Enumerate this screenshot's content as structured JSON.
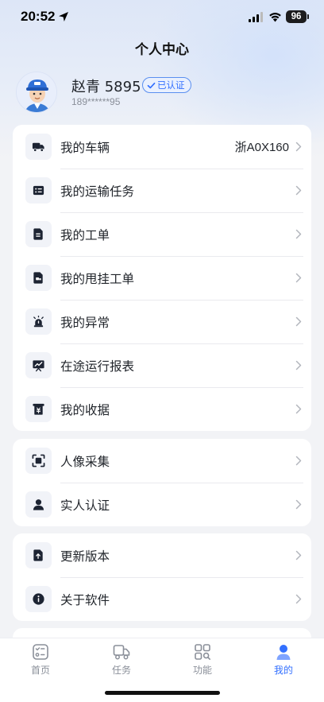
{
  "status_bar": {
    "time": "20:52",
    "battery": "96"
  },
  "page": {
    "title": "个人中心"
  },
  "profile": {
    "name": "赵青 5895",
    "verified_label": "已认证",
    "phone": "189******95"
  },
  "groups": [
    {
      "items": [
        {
          "label": "我的车辆",
          "value": "浙A0X160",
          "icon": "truck-icon"
        },
        {
          "label": "我的运输任务",
          "icon": "task-list-icon"
        },
        {
          "label": "我的工单",
          "icon": "work-order-icon"
        },
        {
          "label": "我的甩挂工单",
          "icon": "trailer-order-icon"
        },
        {
          "label": "我的异常",
          "icon": "alarm-icon"
        },
        {
          "label": "在途运行报表",
          "icon": "report-icon"
        },
        {
          "label": "我的收据",
          "icon": "receipt-icon"
        }
      ]
    },
    {
      "items": [
        {
          "label": "人像采集",
          "icon": "face-scan-icon"
        },
        {
          "label": "实人认证",
          "icon": "person-icon"
        }
      ]
    },
    {
      "items": [
        {
          "label": "更新版本",
          "icon": "update-icon"
        },
        {
          "label": "关于软件",
          "icon": "info-icon"
        }
      ]
    }
  ],
  "tab_bar": {
    "tabs": [
      {
        "label": "首页",
        "icon": "home-icon"
      },
      {
        "label": "任务",
        "icon": "delivery-truck-icon"
      },
      {
        "label": "功能",
        "icon": "grid-search-icon"
      },
      {
        "label": "我的",
        "icon": "profile-icon",
        "active": true
      }
    ]
  },
  "colors": {
    "accent": "#3370ff",
    "icon_dark": "#1d2433",
    "text": "#1f2329",
    "muted": "#8a8f99"
  }
}
